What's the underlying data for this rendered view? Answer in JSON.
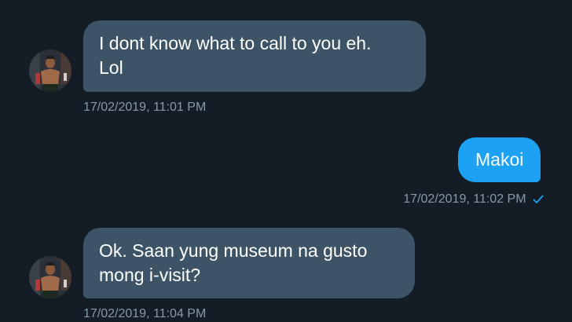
{
  "conversation": {
    "messages": [
      {
        "direction": "incoming",
        "text": "I dont know what to call to you eh.\nLol",
        "timestamp": "17/02/2019, 11:01 PM",
        "avatar": "user-avatar"
      },
      {
        "direction": "outgoing",
        "text": "Makoi",
        "timestamp": "17/02/2019, 11:02 PM",
        "status_icon": "read-check-icon"
      },
      {
        "direction": "incoming",
        "text": "Ok. Saan yung museum na gusto\nmong i-visit?",
        "timestamp": "17/02/2019, 11:04 PM",
        "avatar": "user-avatar"
      }
    ]
  },
  "colors": {
    "background": "#141d26",
    "incoming_bubble": "#3d5466",
    "outgoing_bubble": "#1da1f2",
    "timestamp_text": "#8899a6",
    "read_check": "#1da1f2"
  }
}
